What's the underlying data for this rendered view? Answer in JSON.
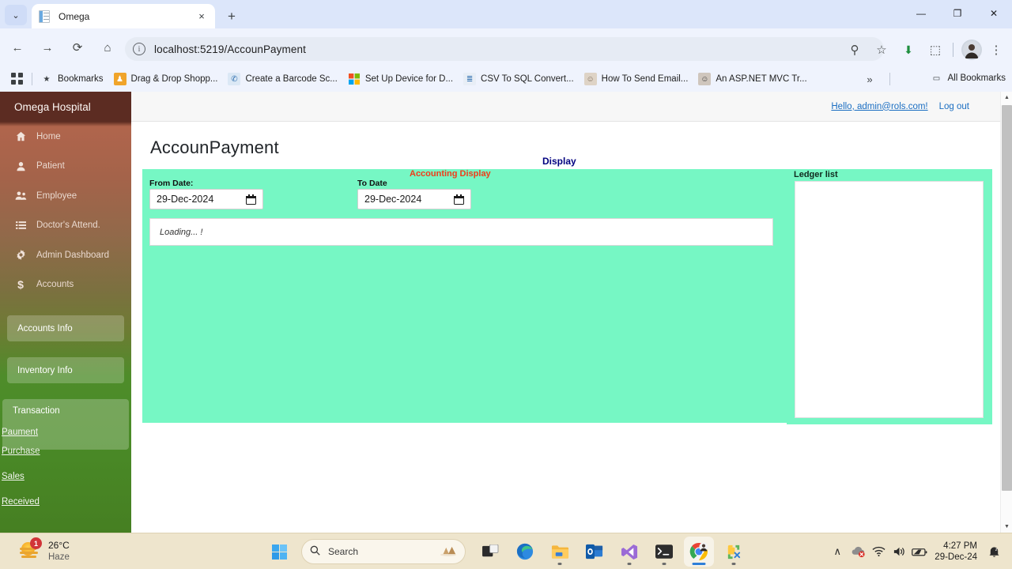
{
  "browser": {
    "tab": {
      "title": "Omega",
      "favicon": "document-icon",
      "close": "×"
    },
    "new_tab": "+",
    "tab_list_chevron": "⌄",
    "window": {
      "minimize": "—",
      "maximize": "❐",
      "close": "✕"
    },
    "nav": {
      "back": "←",
      "forward": "→",
      "reload": "⟳",
      "home": "⌂"
    },
    "omnibox": {
      "url": "localhost:5219/AccounPayment",
      "info_icon": "i"
    },
    "actions": {
      "zoom_search": "⚲",
      "bookmark_star": "☆",
      "download": "⬇",
      "extensions": "⬚",
      "profile": "profile-avatar",
      "menu": "⋮"
    },
    "bookmarks": {
      "apps_grid": "apps-grid-icon",
      "items": [
        {
          "label": "Bookmarks",
          "icon": "★",
          "icon_color": "#3c4043",
          "bg": "transparent"
        },
        {
          "label": "Drag & Drop Shopp...",
          "icon": "♟",
          "icon_color": "#ffffff",
          "bg": "#f0a42a"
        },
        {
          "label": "Create a Barcode Sc...",
          "icon": "✆",
          "icon_color": "#2f6fb0",
          "bg": "#dbe8f5"
        },
        {
          "label": "Set Up Device for D...",
          "icon": "⊞",
          "icon_color": "#ffffff",
          "bg": "#f25022"
        },
        {
          "label": "CSV To SQL Convert...",
          "icon": "≣",
          "icon_color": "#2f6fb0",
          "bg": "#e8eef6"
        },
        {
          "label": "How To Send Email...",
          "icon": "☺",
          "icon_color": "#8a7a6a",
          "bg": "#ded3c6"
        },
        {
          "label": "An ASP.NET MVC Tr...",
          "icon": "☺",
          "icon_color": "#3a3a3a",
          "bg": "#cfc6bd"
        }
      ],
      "overflow": "»",
      "all_bookmarks": {
        "label": "All Bookmarks",
        "icon": "▭"
      }
    }
  },
  "page": {
    "sidebar": {
      "brand": "Omega Hospital",
      "nav_items": [
        {
          "label": "Home",
          "icon": "home-icon",
          "glyph": "⌂"
        },
        {
          "label": "Patient",
          "icon": "person-icon",
          "glyph": "♟"
        },
        {
          "label": "Employee",
          "icon": "people-icon",
          "glyph": "⚇"
        },
        {
          "label": "Doctor's Attend.",
          "icon": "list-icon",
          "glyph": "☰"
        },
        {
          "label": "Admin Dashboard",
          "icon": "gear-icon",
          "glyph": "⚙"
        },
        {
          "label": "Accounts",
          "icon": "dollar-icon",
          "glyph": "$"
        }
      ],
      "sections": [
        {
          "label": "Accounts Info"
        },
        {
          "label": "Inventory Info"
        }
      ],
      "transaction": {
        "label": "Transaction",
        "payment_link": "Paument"
      },
      "links": [
        {
          "label": "Purchase"
        },
        {
          "label": "Sales"
        },
        {
          "label": "Received"
        }
      ]
    },
    "topbar": {
      "greeting": "Hello, admin@rols.com!",
      "logout": "Log out"
    },
    "title": "AccounPayment",
    "display_link": "Display",
    "accounting_display": "Accounting Display",
    "form": {
      "from_label": "From Date:",
      "from_value": "29-Dec-2024",
      "to_label": "To Date",
      "to_value": "29-Dec-2024",
      "loading_text": "Loading... !"
    },
    "ledger": {
      "label": "Ledger list",
      "items": []
    },
    "scrollbar": {
      "up": "▲",
      "down": "▼"
    },
    "colors": {
      "panel_teal": "#76f7c4",
      "display_link": "#000080",
      "accounting_display": "#f03c18",
      "link_blue": "#1b6ec2"
    }
  },
  "taskbar": {
    "weather": {
      "temp": "26°C",
      "condition": "Haze",
      "badge": "1"
    },
    "start": "start-button",
    "search": {
      "placeholder": "Search",
      "doodle": "🏔"
    },
    "apps": [
      {
        "name": "task-view",
        "glyph": "◰"
      },
      {
        "name": "microsoft-edge",
        "glyph": "◐"
      },
      {
        "name": "file-explorer",
        "glyph": "🗁"
      },
      {
        "name": "outlook",
        "glyph": "O"
      },
      {
        "name": "visual-studio",
        "glyph": "∞"
      },
      {
        "name": "terminal",
        "glyph": ">_"
      },
      {
        "name": "google-chrome",
        "glyph": "●"
      },
      {
        "name": "settings-tools",
        "glyph": "⚒"
      }
    ],
    "tray": {
      "chevron": "∧",
      "onedrive": "☁",
      "wifi": "◠",
      "volume": "🔊",
      "battery": "▭",
      "notifications": "🔔"
    },
    "clock": {
      "time": "4:27 PM",
      "date": "29-Dec-24"
    }
  }
}
